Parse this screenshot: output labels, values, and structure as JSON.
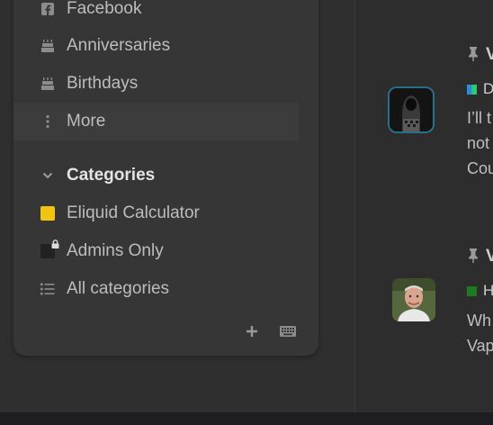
{
  "sidebar": {
    "links": [
      {
        "label": "Facebook",
        "icon": "facebook-icon"
      },
      {
        "label": "Anniversaries",
        "icon": "cake-icon"
      },
      {
        "label": "Birthdays",
        "icon": "cake-icon"
      },
      {
        "label": "More",
        "icon": "vertical-ellipsis-icon"
      }
    ],
    "categories_header": "Categories",
    "categories": [
      {
        "label": "Eliquid Calculator",
        "color": "#f1c40f"
      },
      {
        "label": "Admins Only",
        "color": "#222222",
        "locked": true
      },
      {
        "label": "All categories",
        "icon": "list-icon"
      }
    ],
    "footer": {
      "add_icon": "plus-icon",
      "keyboard_icon": "keyboard-icon"
    }
  },
  "feed": {
    "topics": [
      {
        "title_fragment": "V",
        "pinned": true,
        "category_initial": "D",
        "category_colors": [
          "#2e8bd6",
          "#2ecc71"
        ],
        "excerpt_lines": [
          "I’ll t",
          "not",
          "Cou"
        ]
      },
      {
        "title_fragment": "V",
        "pinned": true,
        "category_initial": "H",
        "category_colors": [
          "#1e7a1e"
        ],
        "excerpt_lines": [
          "Wh",
          "Vap"
        ]
      }
    ]
  }
}
